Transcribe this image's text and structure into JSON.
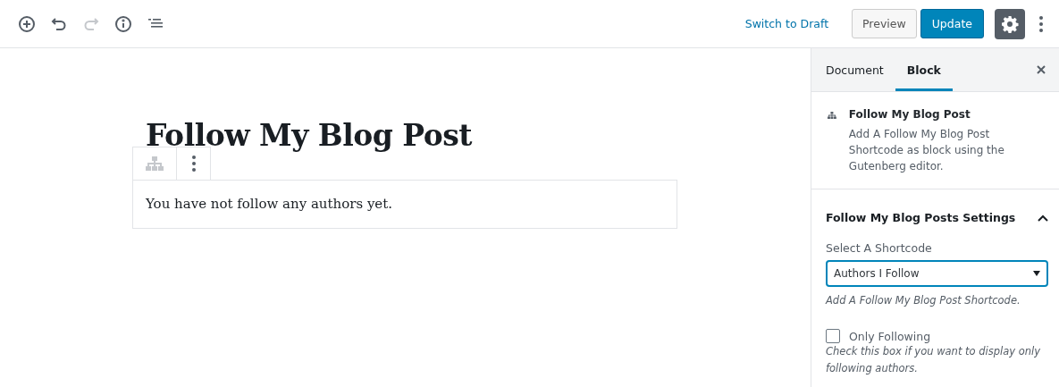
{
  "toolbar": {
    "tools": [
      {
        "kind": "add",
        "disabled": false
      },
      {
        "kind": "undo",
        "disabled": false
      },
      {
        "kind": "redo",
        "disabled": true
      },
      {
        "kind": "info",
        "disabled": false
      },
      {
        "kind": "outline",
        "disabled": false
      }
    ],
    "switch_link": "Switch to Draft",
    "preview": "Preview",
    "update": "Update",
    "settings_selected": true
  },
  "editor": {
    "title": "Follow My Blog Post",
    "block_text": "You have not follow any authors yet."
  },
  "sidebar": {
    "tabs": [
      {
        "label": "Document",
        "selected": false
      },
      {
        "label": "Block",
        "selected": true
      }
    ],
    "block_card": {
      "name": "Follow My Blog Post",
      "description": "Add A Follow My Blog Post Shortcode as block using the Gutenberg editor."
    },
    "panel": {
      "title": "Follow My Blog Posts Settings",
      "expanded": true,
      "select_label": "Select A Shortcode",
      "select_value": "Authors I Follow",
      "select_help": "Add A Follow My Blog Post Shortcode.",
      "checkbox": {
        "label": "Only Following",
        "checked": false,
        "help": "Check this box if you want to display only following authors."
      }
    }
  }
}
